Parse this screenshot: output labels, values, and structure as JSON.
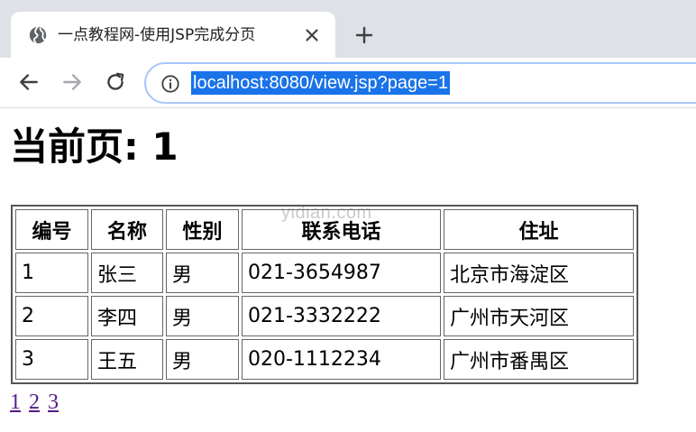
{
  "browser": {
    "tab": {
      "title": "一点教程网-使用JSP完成分页",
      "favicon": "globe-icon",
      "close": "close-icon"
    },
    "new_tab": "plus-icon",
    "nav": {
      "back": "back-arrow-icon",
      "forward": "forward-arrow-icon",
      "reload": "reload-icon"
    },
    "address_bar": {
      "info_icon": "info-icon",
      "url": "localhost:8080/view.jsp?page=1"
    }
  },
  "page": {
    "heading": "当前页: 1",
    "watermark": "yidian.com",
    "table": {
      "headers": [
        "编号",
        "名称",
        "性别",
        "联系电话",
        "住址"
      ],
      "rows": [
        [
          "1",
          "张三",
          "男",
          "021-3654987",
          "北京市海淀区"
        ],
        [
          "2",
          "李四",
          "男",
          "021-3332222",
          "广州市天河区"
        ],
        [
          "3",
          "王五",
          "男",
          "020-1112234",
          "广州市番禺区"
        ]
      ]
    },
    "pagination": [
      "1",
      "2",
      "3"
    ]
  },
  "colors": {
    "selection": "#1a73e8",
    "link_visited": "#551a8b",
    "tabstrip": "#dee1e6"
  }
}
